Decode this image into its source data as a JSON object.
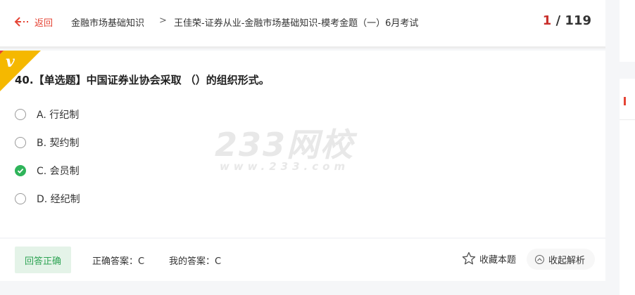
{
  "header": {
    "back_label": "返回",
    "crumb1": "金融市场基础知识",
    "crumb2": "王佳荣-证券从业-金融市场基础知识-模考金题（一）6月考试",
    "current": "1",
    "total": "119"
  },
  "question": {
    "badge_letter": "v",
    "title": "40.【单选题】中国证券业协会采取  （）的组织形式。",
    "options": [
      {
        "label": "A. 行纪制",
        "selected": false
      },
      {
        "label": "B. 契约制",
        "selected": false
      },
      {
        "label": "C. 会员制",
        "selected": true
      },
      {
        "label": "D. 经纪制",
        "selected": false
      }
    ]
  },
  "watermark": {
    "main": "233网校",
    "url": "www.233.com"
  },
  "answer": {
    "status": "回答正确",
    "correct_answer": "正确答案：C",
    "my_answer": "我的答案：C",
    "favorite_label": "收藏本题",
    "collapse_label": "收起解析"
  },
  "colors": {
    "accent": "#e54435",
    "correct": "#2fb45a",
    "correct_bg": "#e4f3e8",
    "vip_gold": "#f5b800"
  },
  "icons": [
    "back-arrow-icon",
    "vip-badge-icon",
    "check-icon",
    "star-icon",
    "chevron-up-icon"
  ]
}
